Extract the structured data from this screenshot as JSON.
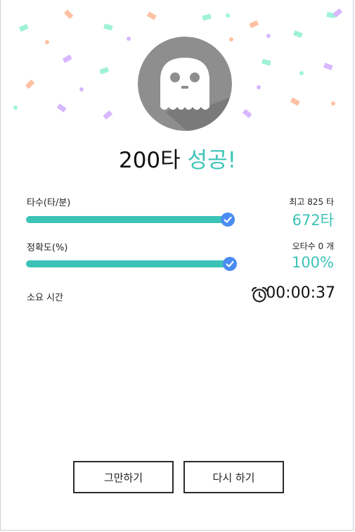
{
  "result": {
    "count_text": "200타",
    "success_text": "성공!",
    "accent_color": "#3cc3b7"
  },
  "speed": {
    "label": "타수(타/분)",
    "best_text": "최고 825 타",
    "value_text": "672타",
    "progress": 0.99
  },
  "accuracy": {
    "label": "정확도(%)",
    "errors_text": "오타수 0 개",
    "value_text": "100%",
    "progress": 1.0
  },
  "elapsed": {
    "label": "소요 시간",
    "icon": "alarm-clock-icon",
    "value_text": "00:00:37"
  },
  "buttons": {
    "stop_label": "그만하기",
    "retry_label": "다시 하기"
  },
  "avatar": {
    "icon": "ghost-icon",
    "bg_color": "#8e8e8e"
  }
}
